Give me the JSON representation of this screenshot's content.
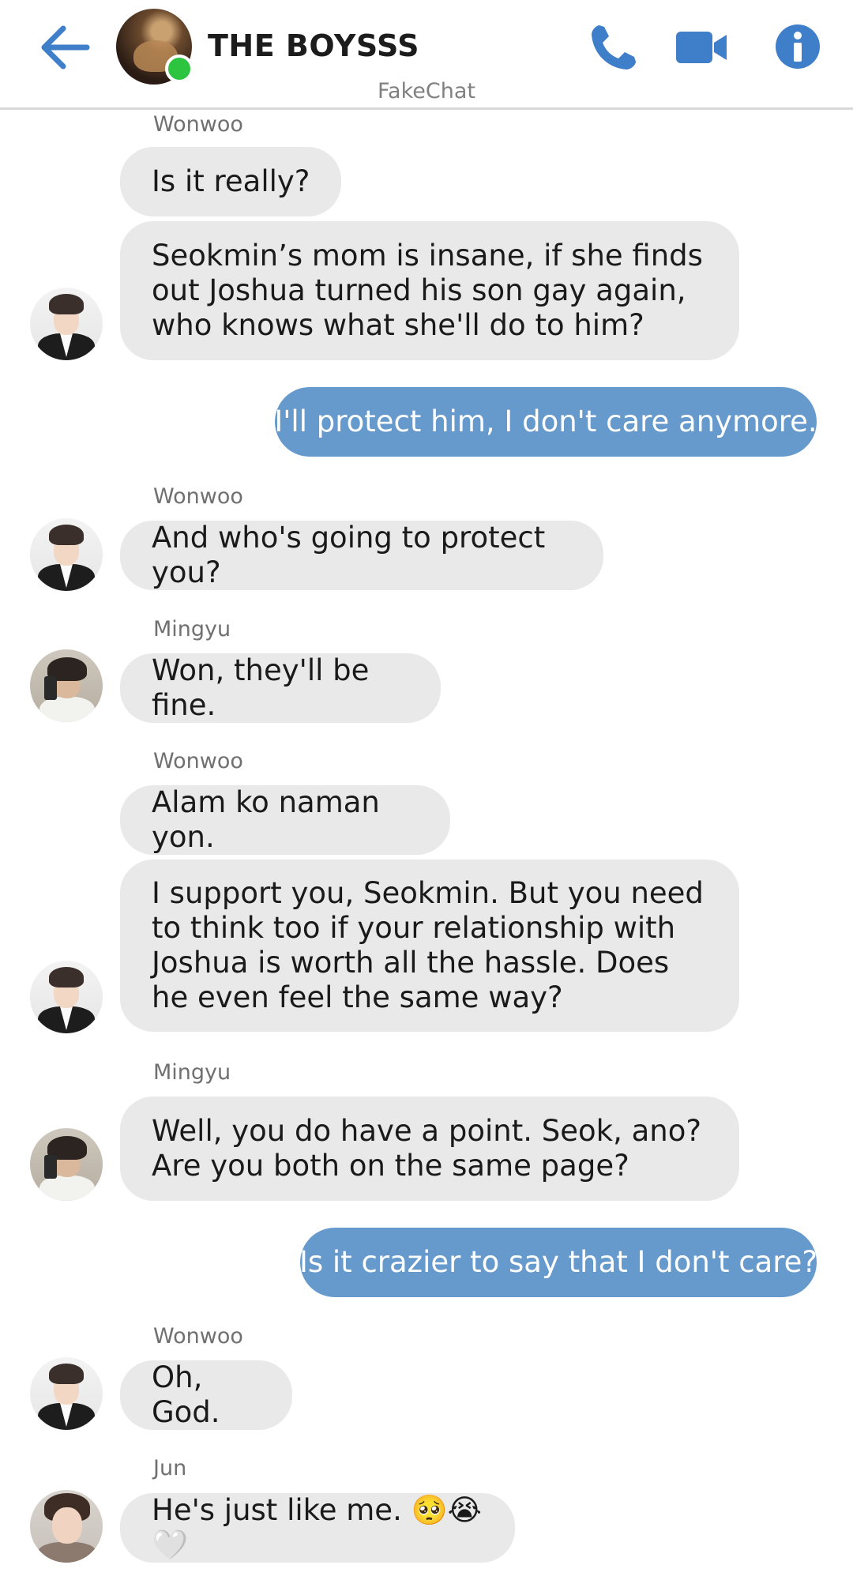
{
  "header": {
    "title": "THE BOYSSS",
    "watermark": "FakeChat"
  },
  "colors": {
    "accent": "#3f7ec8",
    "incoming_bubble": "#e9e9e9",
    "outgoing_bubble": "#6699cc",
    "online": "#2dc43f"
  },
  "icons": [
    "back-arrow-icon",
    "phone-icon",
    "video-camera-icon",
    "info-icon"
  ],
  "messages": [
    {
      "sender": "Wonwoo",
      "text": "Is it really?"
    },
    {
      "sender": "Wonwoo",
      "text": "Seokmin’s mom is insane, if she finds out Joshua turned his son gay again, who knows what she'll do to him?"
    },
    {
      "sender": "me",
      "text": "I'll protect him, I don't care anymore."
    },
    {
      "sender": "Wonwoo",
      "text": "And who's going to protect you?"
    },
    {
      "sender": "Mingyu",
      "text": "Won, they'll be fine."
    },
    {
      "sender": "Wonwoo",
      "text": "Alam ko naman yon."
    },
    {
      "sender": "Wonwoo",
      "text": "I support you, Seokmin. But you need to think too if your relationship with Joshua is worth all the hassle. Does he even feel the same way?"
    },
    {
      "sender": "Mingyu",
      "text": "Well, you do have a point. Seok, ano? Are you both on the same page?"
    },
    {
      "sender": "me",
      "text": "Is it crazier to say that I don't care?"
    },
    {
      "sender": "Wonwoo",
      "text": "Oh, God."
    },
    {
      "sender": "Jun",
      "text": "He's just like me. 🥺😭🤍"
    }
  ]
}
